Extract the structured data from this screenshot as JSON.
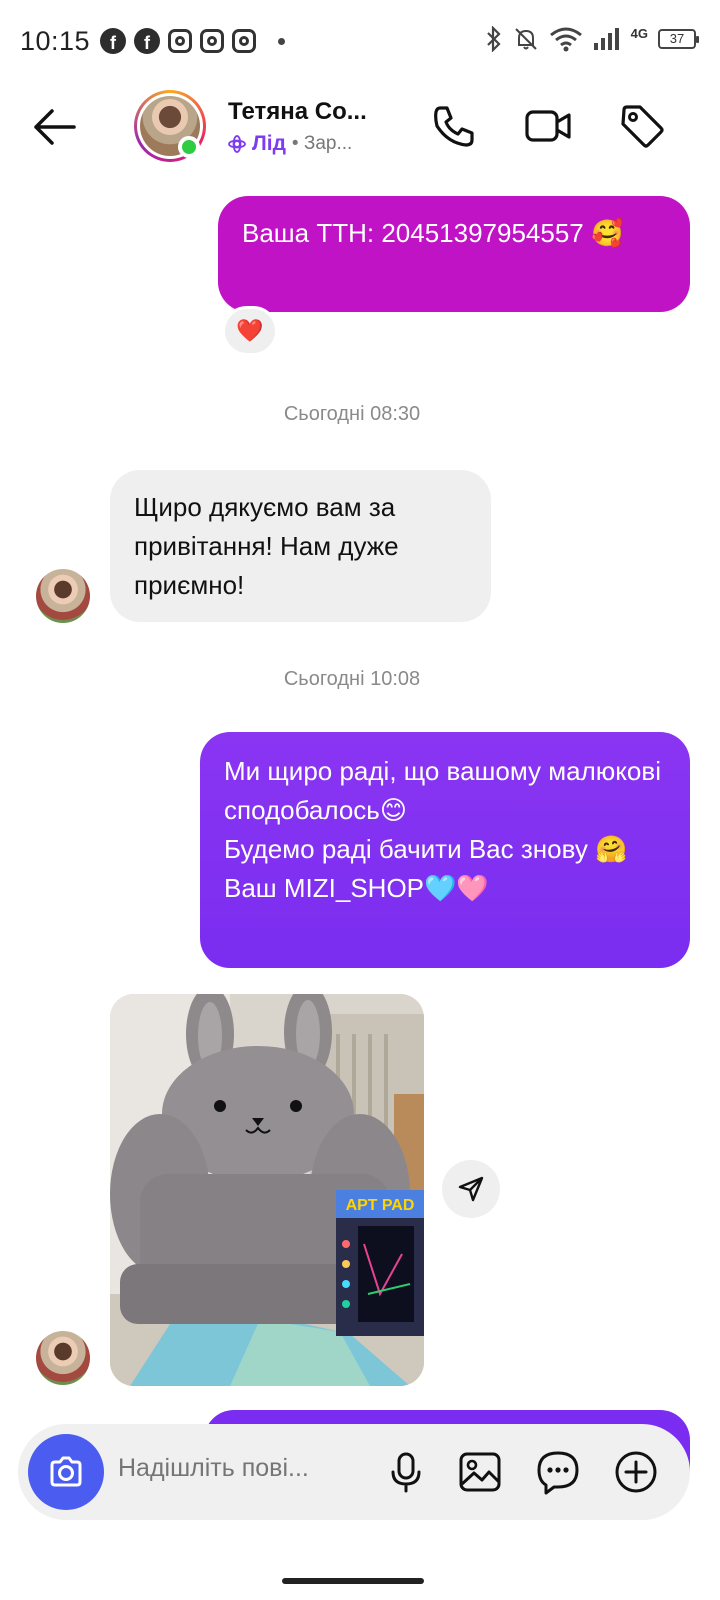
{
  "status_bar": {
    "time": "10:15",
    "network": "4G",
    "battery": "37"
  },
  "header": {
    "contact_name": "Тетяна Со...",
    "lead_label": "Лід",
    "subtitle_rest": "• Зар..."
  },
  "messages": [
    {
      "id": "ttn",
      "direction": "outgoing",
      "text": "Ваша ТТН: 20451397954557 🥰",
      "reaction": "❤️"
    },
    {
      "id": "ts1",
      "type": "timestamp",
      "text": "Сьогодні 08:30"
    },
    {
      "id": "in1",
      "direction": "incoming",
      "text": "Щиро дякуємо вам за привітання! Нам дуже приємно!"
    },
    {
      "id": "ts2",
      "type": "timestamp",
      "text": "Сьогодні 10:08"
    },
    {
      "id": "out2",
      "direction": "outgoing",
      "lines": [
        "Ми щиро раді, що вашому малюкові сподобалось😊",
        "Будемо раді бачити Вас знову 🤗",
        "Ваш MIZI_SHOP🩵🩷"
      ]
    },
    {
      "id": "photo1",
      "direction": "incoming",
      "type": "photo",
      "box_text": "АРТ PAD"
    }
  ],
  "composer": {
    "placeholder": "Надішліть пові..."
  },
  "colors": {
    "ttn_bubble": "#c013c6",
    "outgoing_bubble": "#7a2df0",
    "incoming_bubble": "#efefef",
    "camera_button": "#4b5cf0",
    "lead_accent": "#7e3cf0",
    "online_dot": "#2ecc40"
  },
  "icons": [
    "facebook-icon",
    "instagram-icon",
    "bluetooth-icon",
    "mute-icon",
    "wifi-icon",
    "signal-icon",
    "battery-icon",
    "back-arrow-icon",
    "phone-icon",
    "video-icon",
    "tag-icon",
    "share-icon",
    "camera-icon",
    "mic-icon",
    "gallery-icon",
    "sticker-icon",
    "plus-icon"
  ]
}
